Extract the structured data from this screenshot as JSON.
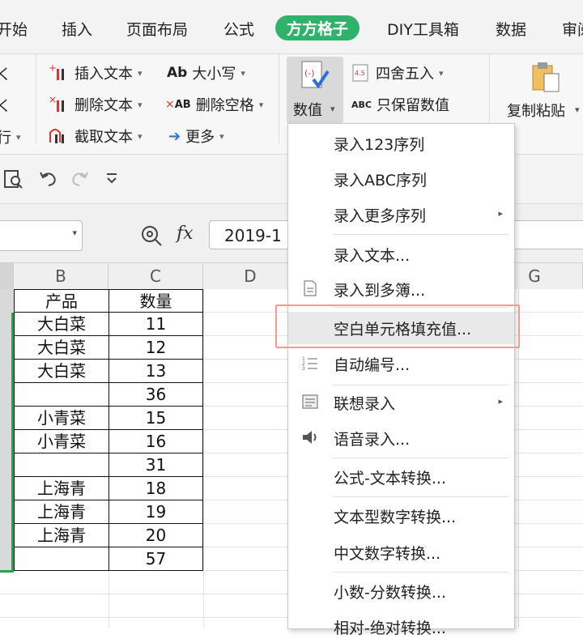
{
  "tabs": [
    "开始",
    "插入",
    "页面布局",
    "公式",
    "方方格子",
    "DIY工具箱",
    "数据",
    "审阅"
  ],
  "ribbon": {
    "left_partial": [
      "く",
      "く",
      "行"
    ],
    "insert_text": "插入文本",
    "delete_text": "删除文本",
    "extract_text": "截取文本",
    "case": "大小写",
    "delete_space": "删除空格",
    "more": "更多",
    "numeric": "数值",
    "round": "四舍五入",
    "keep_numeric": "只保留数值",
    "copy_paste": "复制粘贴",
    "ab_glyph": "Ab",
    "abc_glyph": "ABC"
  },
  "formula_bar": {
    "fx": "fx",
    "value": "2019-1"
  },
  "columns": [
    "B",
    "C",
    "D",
    "G"
  ],
  "table": {
    "headers": [
      "产品",
      "数量"
    ],
    "rows": [
      [
        "大白菜",
        "11"
      ],
      [
        "大白菜",
        "12"
      ],
      [
        "大白菜",
        "13"
      ],
      [
        "",
        "36"
      ],
      [
        "小青菜",
        "15"
      ],
      [
        "小青菜",
        "16"
      ],
      [
        "",
        "31"
      ],
      [
        "上海青",
        "18"
      ],
      [
        "上海青",
        "19"
      ],
      [
        "上海青",
        "20"
      ],
      [
        "",
        "57"
      ]
    ]
  },
  "menu": {
    "items": [
      "录入123序列",
      "录入ABC序列",
      "录入更多序列",
      "录入文本...",
      "录入到多簿...",
      "空白单元格填充值...",
      "自动编号...",
      "联想录入",
      "语音录入...",
      "公式-文本转换...",
      "文本型数字转换...",
      "中文数字转换...",
      "小数-分数转换...",
      "相对-绝对转换..."
    ]
  },
  "colors": {
    "accent": "#2fb26a",
    "highlight_border": "#f29b8e",
    "selection_green": "#2e9e4f"
  }
}
